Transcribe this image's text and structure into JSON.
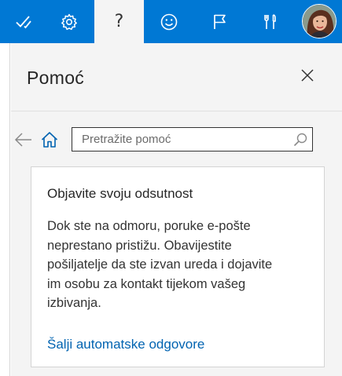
{
  "topbar": {
    "accent_color": "#0078d4",
    "buttons": [
      {
        "name": "todo",
        "icon": "checkmark-icon"
      },
      {
        "name": "settings",
        "icon": "gear-icon"
      },
      {
        "name": "help",
        "icon": "question-icon",
        "glyph": "?"
      },
      {
        "name": "feedback",
        "icon": "smiley-icon"
      },
      {
        "name": "whats-new",
        "icon": "flag-icon"
      },
      {
        "name": "tools",
        "icon": "tools-icon"
      }
    ],
    "avatar": {
      "icon": "user-avatar"
    }
  },
  "help_panel": {
    "title": "Pomoć",
    "search": {
      "placeholder": "Pretražite pomoć",
      "value": ""
    },
    "card": {
      "title": "Objavite svoju odsutnost",
      "body_lines": [
        "Dok ste na odmoru, poruke e-pošte",
        "neprestano pristižu. Obavijestite",
        "pošiljatelje da ste izvan ureda i dojavite",
        "im osobu za kontakt tijekom vašeg",
        "izbivanja."
      ],
      "link": "Šalji automatske odgovore"
    }
  }
}
